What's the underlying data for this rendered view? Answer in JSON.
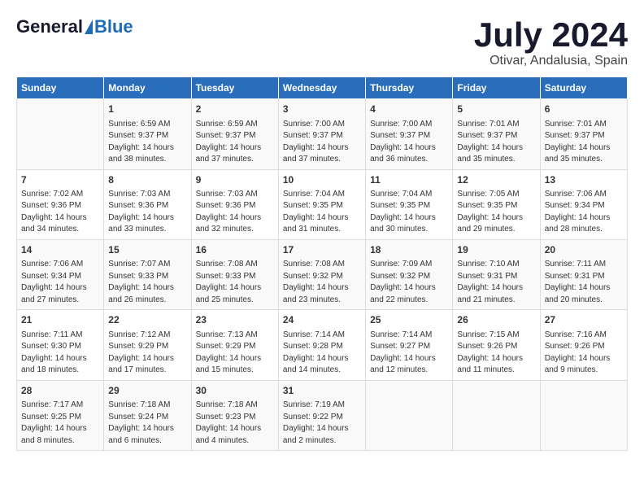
{
  "header": {
    "logo_general": "General",
    "logo_blue": "Blue",
    "month": "July 2024",
    "location": "Otivar, Andalusia, Spain"
  },
  "weekdays": [
    "Sunday",
    "Monday",
    "Tuesday",
    "Wednesday",
    "Thursday",
    "Friday",
    "Saturday"
  ],
  "weeks": [
    [
      {
        "day": "",
        "info": ""
      },
      {
        "day": "1",
        "info": "Sunrise: 6:59 AM\nSunset: 9:37 PM\nDaylight: 14 hours\nand 38 minutes."
      },
      {
        "day": "2",
        "info": "Sunrise: 6:59 AM\nSunset: 9:37 PM\nDaylight: 14 hours\nand 37 minutes."
      },
      {
        "day": "3",
        "info": "Sunrise: 7:00 AM\nSunset: 9:37 PM\nDaylight: 14 hours\nand 37 minutes."
      },
      {
        "day": "4",
        "info": "Sunrise: 7:00 AM\nSunset: 9:37 PM\nDaylight: 14 hours\nand 36 minutes."
      },
      {
        "day": "5",
        "info": "Sunrise: 7:01 AM\nSunset: 9:37 PM\nDaylight: 14 hours\nand 35 minutes."
      },
      {
        "day": "6",
        "info": "Sunrise: 7:01 AM\nSunset: 9:37 PM\nDaylight: 14 hours\nand 35 minutes."
      }
    ],
    [
      {
        "day": "7",
        "info": "Sunrise: 7:02 AM\nSunset: 9:36 PM\nDaylight: 14 hours\nand 34 minutes."
      },
      {
        "day": "8",
        "info": "Sunrise: 7:03 AM\nSunset: 9:36 PM\nDaylight: 14 hours\nand 33 minutes."
      },
      {
        "day": "9",
        "info": "Sunrise: 7:03 AM\nSunset: 9:36 PM\nDaylight: 14 hours\nand 32 minutes."
      },
      {
        "day": "10",
        "info": "Sunrise: 7:04 AM\nSunset: 9:35 PM\nDaylight: 14 hours\nand 31 minutes."
      },
      {
        "day": "11",
        "info": "Sunrise: 7:04 AM\nSunset: 9:35 PM\nDaylight: 14 hours\nand 30 minutes."
      },
      {
        "day": "12",
        "info": "Sunrise: 7:05 AM\nSunset: 9:35 PM\nDaylight: 14 hours\nand 29 minutes."
      },
      {
        "day": "13",
        "info": "Sunrise: 7:06 AM\nSunset: 9:34 PM\nDaylight: 14 hours\nand 28 minutes."
      }
    ],
    [
      {
        "day": "14",
        "info": "Sunrise: 7:06 AM\nSunset: 9:34 PM\nDaylight: 14 hours\nand 27 minutes."
      },
      {
        "day": "15",
        "info": "Sunrise: 7:07 AM\nSunset: 9:33 PM\nDaylight: 14 hours\nand 26 minutes."
      },
      {
        "day": "16",
        "info": "Sunrise: 7:08 AM\nSunset: 9:33 PM\nDaylight: 14 hours\nand 25 minutes."
      },
      {
        "day": "17",
        "info": "Sunrise: 7:08 AM\nSunset: 9:32 PM\nDaylight: 14 hours\nand 23 minutes."
      },
      {
        "day": "18",
        "info": "Sunrise: 7:09 AM\nSunset: 9:32 PM\nDaylight: 14 hours\nand 22 minutes."
      },
      {
        "day": "19",
        "info": "Sunrise: 7:10 AM\nSunset: 9:31 PM\nDaylight: 14 hours\nand 21 minutes."
      },
      {
        "day": "20",
        "info": "Sunrise: 7:11 AM\nSunset: 9:31 PM\nDaylight: 14 hours\nand 20 minutes."
      }
    ],
    [
      {
        "day": "21",
        "info": "Sunrise: 7:11 AM\nSunset: 9:30 PM\nDaylight: 14 hours\nand 18 minutes."
      },
      {
        "day": "22",
        "info": "Sunrise: 7:12 AM\nSunset: 9:29 PM\nDaylight: 14 hours\nand 17 minutes."
      },
      {
        "day": "23",
        "info": "Sunrise: 7:13 AM\nSunset: 9:29 PM\nDaylight: 14 hours\nand 15 minutes."
      },
      {
        "day": "24",
        "info": "Sunrise: 7:14 AM\nSunset: 9:28 PM\nDaylight: 14 hours\nand 14 minutes."
      },
      {
        "day": "25",
        "info": "Sunrise: 7:14 AM\nSunset: 9:27 PM\nDaylight: 14 hours\nand 12 minutes."
      },
      {
        "day": "26",
        "info": "Sunrise: 7:15 AM\nSunset: 9:26 PM\nDaylight: 14 hours\nand 11 minutes."
      },
      {
        "day": "27",
        "info": "Sunrise: 7:16 AM\nSunset: 9:26 PM\nDaylight: 14 hours\nand 9 minutes."
      }
    ],
    [
      {
        "day": "28",
        "info": "Sunrise: 7:17 AM\nSunset: 9:25 PM\nDaylight: 14 hours\nand 8 minutes."
      },
      {
        "day": "29",
        "info": "Sunrise: 7:18 AM\nSunset: 9:24 PM\nDaylight: 14 hours\nand 6 minutes."
      },
      {
        "day": "30",
        "info": "Sunrise: 7:18 AM\nSunset: 9:23 PM\nDaylight: 14 hours\nand 4 minutes."
      },
      {
        "day": "31",
        "info": "Sunrise: 7:19 AM\nSunset: 9:22 PM\nDaylight: 14 hours\nand 2 minutes."
      },
      {
        "day": "",
        "info": ""
      },
      {
        "day": "",
        "info": ""
      },
      {
        "day": "",
        "info": ""
      }
    ]
  ]
}
